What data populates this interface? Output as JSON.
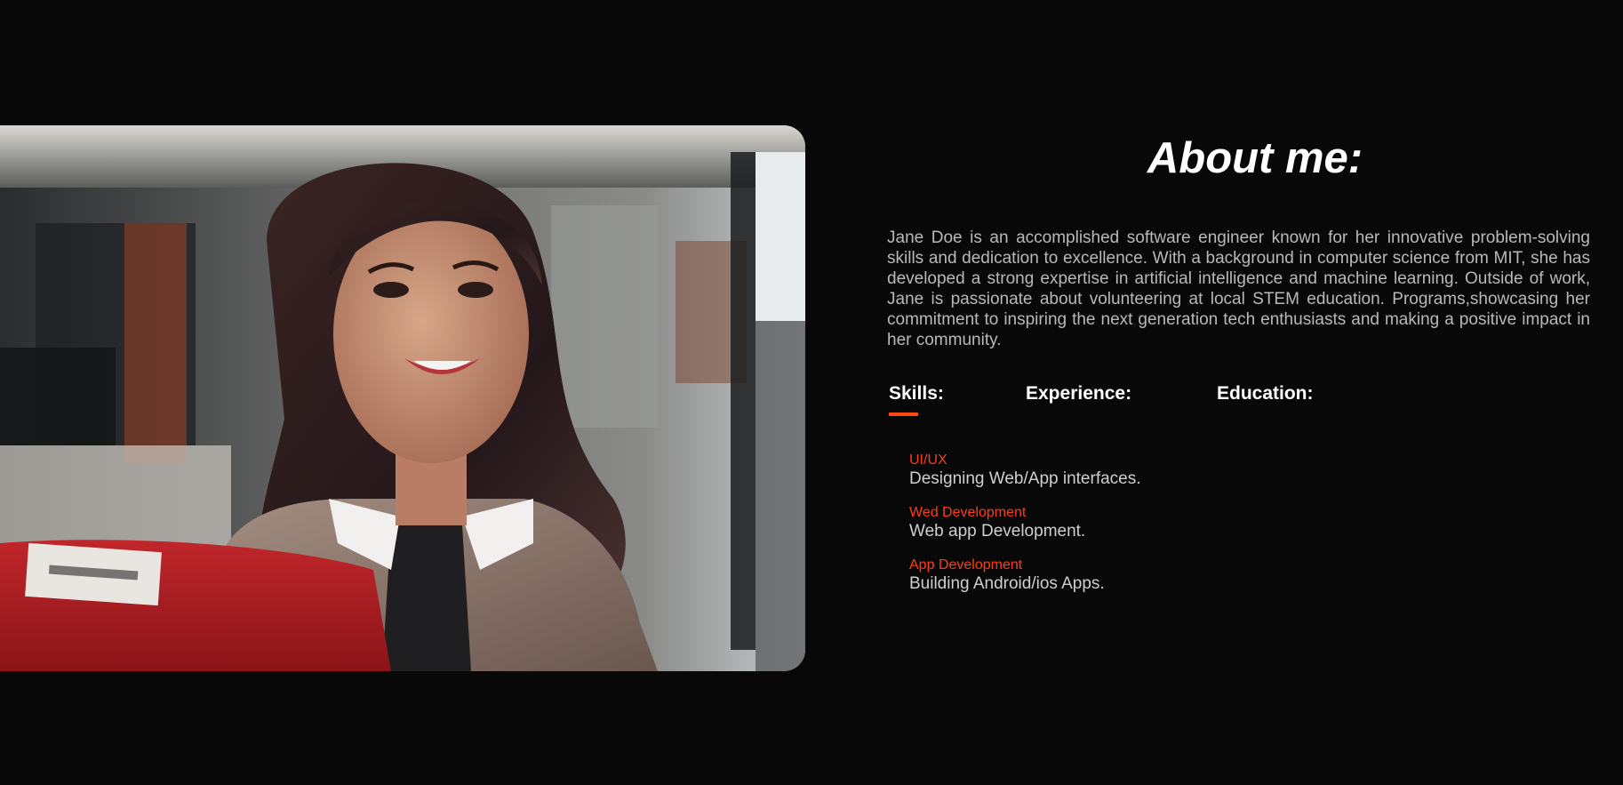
{
  "about": {
    "title": "About me:",
    "bio": "Jane Doe is an accomplished software engineer known for her innovative problem-solving skills and dedication to excellence. With a background in computer science from MIT, she has developed a strong expertise in artificial intelligence and machine learning. Outside of work, Jane is passionate about volunteering at local STEM education. Programs,showcasing her commitment to inspiring the next generation tech enthusiasts and making a positive impact in her community."
  },
  "tabs": {
    "skills": "Skills:",
    "experience": "Experience:",
    "education": "Education:",
    "active": "skills"
  },
  "skills": [
    {
      "name": "UI/UX",
      "description": "Designing Web/App interfaces."
    },
    {
      "name": "Wed Development",
      "description": "Web app Development."
    },
    {
      "name": "App Development",
      "description": "Building Android/ios Apps."
    }
  ],
  "colors": {
    "background": "#080808",
    "accent": "#ff4b0f",
    "title": "#ffffff",
    "body_text": "#b9b9b9"
  }
}
